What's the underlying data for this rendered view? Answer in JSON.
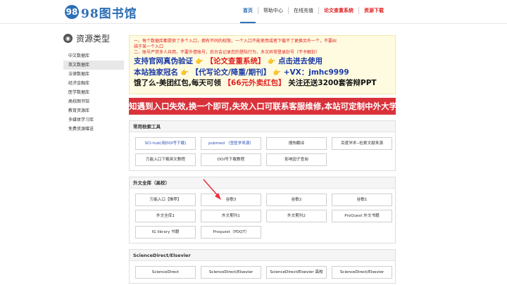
{
  "header": {
    "logo_badge": "98",
    "logo_text": "98图书馆",
    "nav": [
      {
        "label": "首页",
        "style": "active"
      },
      {
        "label": "帮助中心",
        "style": ""
      },
      {
        "label": "在线充值",
        "style": ""
      },
      {
        "label": "论文查重系统",
        "style": "red"
      },
      {
        "label": "资源下载",
        "style": "red"
      }
    ]
  },
  "sidebar": {
    "title": "资源类型",
    "items": [
      "中文数据库",
      "英文数据库",
      "法律数据库",
      "经济金融库",
      "医学数据库",
      "高校图书馆",
      "教育资源库",
      "多媒体学习库",
      "免费资源赠送"
    ],
    "active_index": 1
  },
  "notice": {
    "line1": "一、每个数据库都提供了多个入口，拥有不同的权限，一个入口不能使用或者下载不了更换另外一个，不要纠",
    "line2": "结于某一个入口",
    "line3": "二、账号严禁多人共用，不要外借账号，后台会记录您的登陆行为，多次异常登录封号（不予解封）",
    "promo_a1": "支持官网真伪验证",
    "promo_a2": "【论文查重系统】",
    "promo_a3": "点击进去使用",
    "promo_b1": "本站独家冠名",
    "promo_b2": "【代写论文/降重/期刊】",
    "promo_b3": "+VX：jmhc9999",
    "promo_c1": "饿了么-美团红包,每天可领",
    "promo_c2": "【66元外卖红包】",
    "promo_c3": "关注还送3200套答辩PPT",
    "hand_icon": "👉"
  },
  "banner": "知遇到入口失效,换一个即可,失效入口可联系客服维修,本站可定制中外大学帐号",
  "sections": [
    {
      "title": "常用检索工具",
      "buttons": [
        {
          "label": "SCI-hub(用DOI号下载)",
          "color": "blue"
        },
        {
          "label": "pubmed （查医学来源）",
          "color": "blue"
        },
        {
          "label": "搜狗翻译",
          "color": ""
        },
        {
          "label": "百度学术--检索文献来源",
          "color": ""
        },
        {
          "label": "万能入口下载英文教程",
          "color": ""
        },
        {
          "label": "DOI号下载教程",
          "color": ""
        },
        {
          "label": "影响因子查询",
          "color": ""
        }
      ]
    },
    {
      "title": "外文全库（高校）",
      "buttons": [
        {
          "label": "万能入口【推荐】",
          "color": ""
        },
        {
          "label": "谷歌3",
          "color": ""
        },
        {
          "label": "谷歌2",
          "color": ""
        },
        {
          "label": "谷歌1",
          "color": ""
        },
        {
          "label": "外文全库1",
          "color": ""
        },
        {
          "label": "外文期刊1",
          "color": ""
        },
        {
          "label": "外文期刊2",
          "color": ""
        },
        {
          "label": "ProQuest 外文书籍",
          "color": ""
        },
        {
          "label": "IG library 书籍",
          "color": ""
        },
        {
          "label": "Proquest（PDQT）",
          "color": ""
        }
      ]
    },
    {
      "title": "ScienceDirect/Elsevier",
      "buttons": [
        {
          "label": "ScienceDirect",
          "color": "dark"
        },
        {
          "label": "ScienceDirect/Elsevier",
          "color": "dark"
        },
        {
          "label": "ScienceDirect/Elsevier 高校",
          "color": "dark"
        },
        {
          "label": "ScienceDirect/Elsevier",
          "color": "dark"
        }
      ]
    }
  ],
  "colors": {
    "brand": "#2d6fb6",
    "banner": "#d9323a",
    "alert": "#e02020",
    "arrow": "#e8323c"
  }
}
